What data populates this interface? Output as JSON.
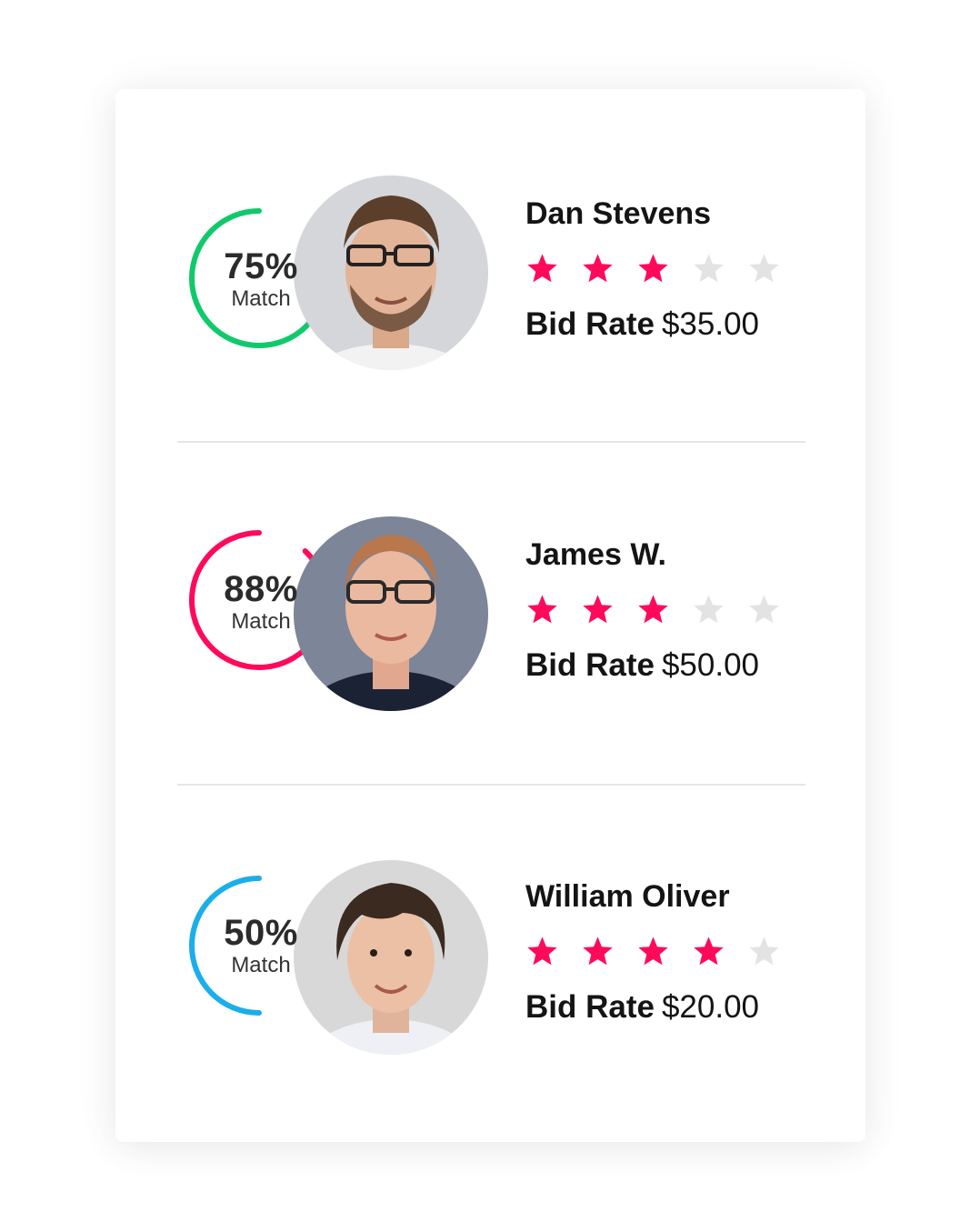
{
  "colors": {
    "star_filled": "#ff0a5a",
    "star_empty": "#e3e3e3",
    "divider": "#e6e6e6"
  },
  "candidates": [
    {
      "name": "Dan Stevens",
      "match_percent_label": "75%",
      "match_percent": 75,
      "match_label": "Match",
      "ring_color": "#10c96b",
      "rating": 3,
      "rating_max": 5,
      "bid_rate_label": "Bid Rate",
      "bid_rate_value": "$35.00"
    },
    {
      "name": "James W.",
      "match_percent_label": "88%",
      "match_percent": 88,
      "match_label": "Match",
      "ring_color": "#ff0a5a",
      "rating": 3,
      "rating_max": 5,
      "bid_rate_label": "Bid Rate",
      "bid_rate_value": "$50.00"
    },
    {
      "name": "William Oliver",
      "match_percent_label": "50%",
      "match_percent": 50,
      "match_label": "Match",
      "ring_color": "#1aaeea",
      "rating": 4,
      "rating_max": 5,
      "bid_rate_label": "Bid Rate",
      "bid_rate_value": "$20.00"
    }
  ]
}
